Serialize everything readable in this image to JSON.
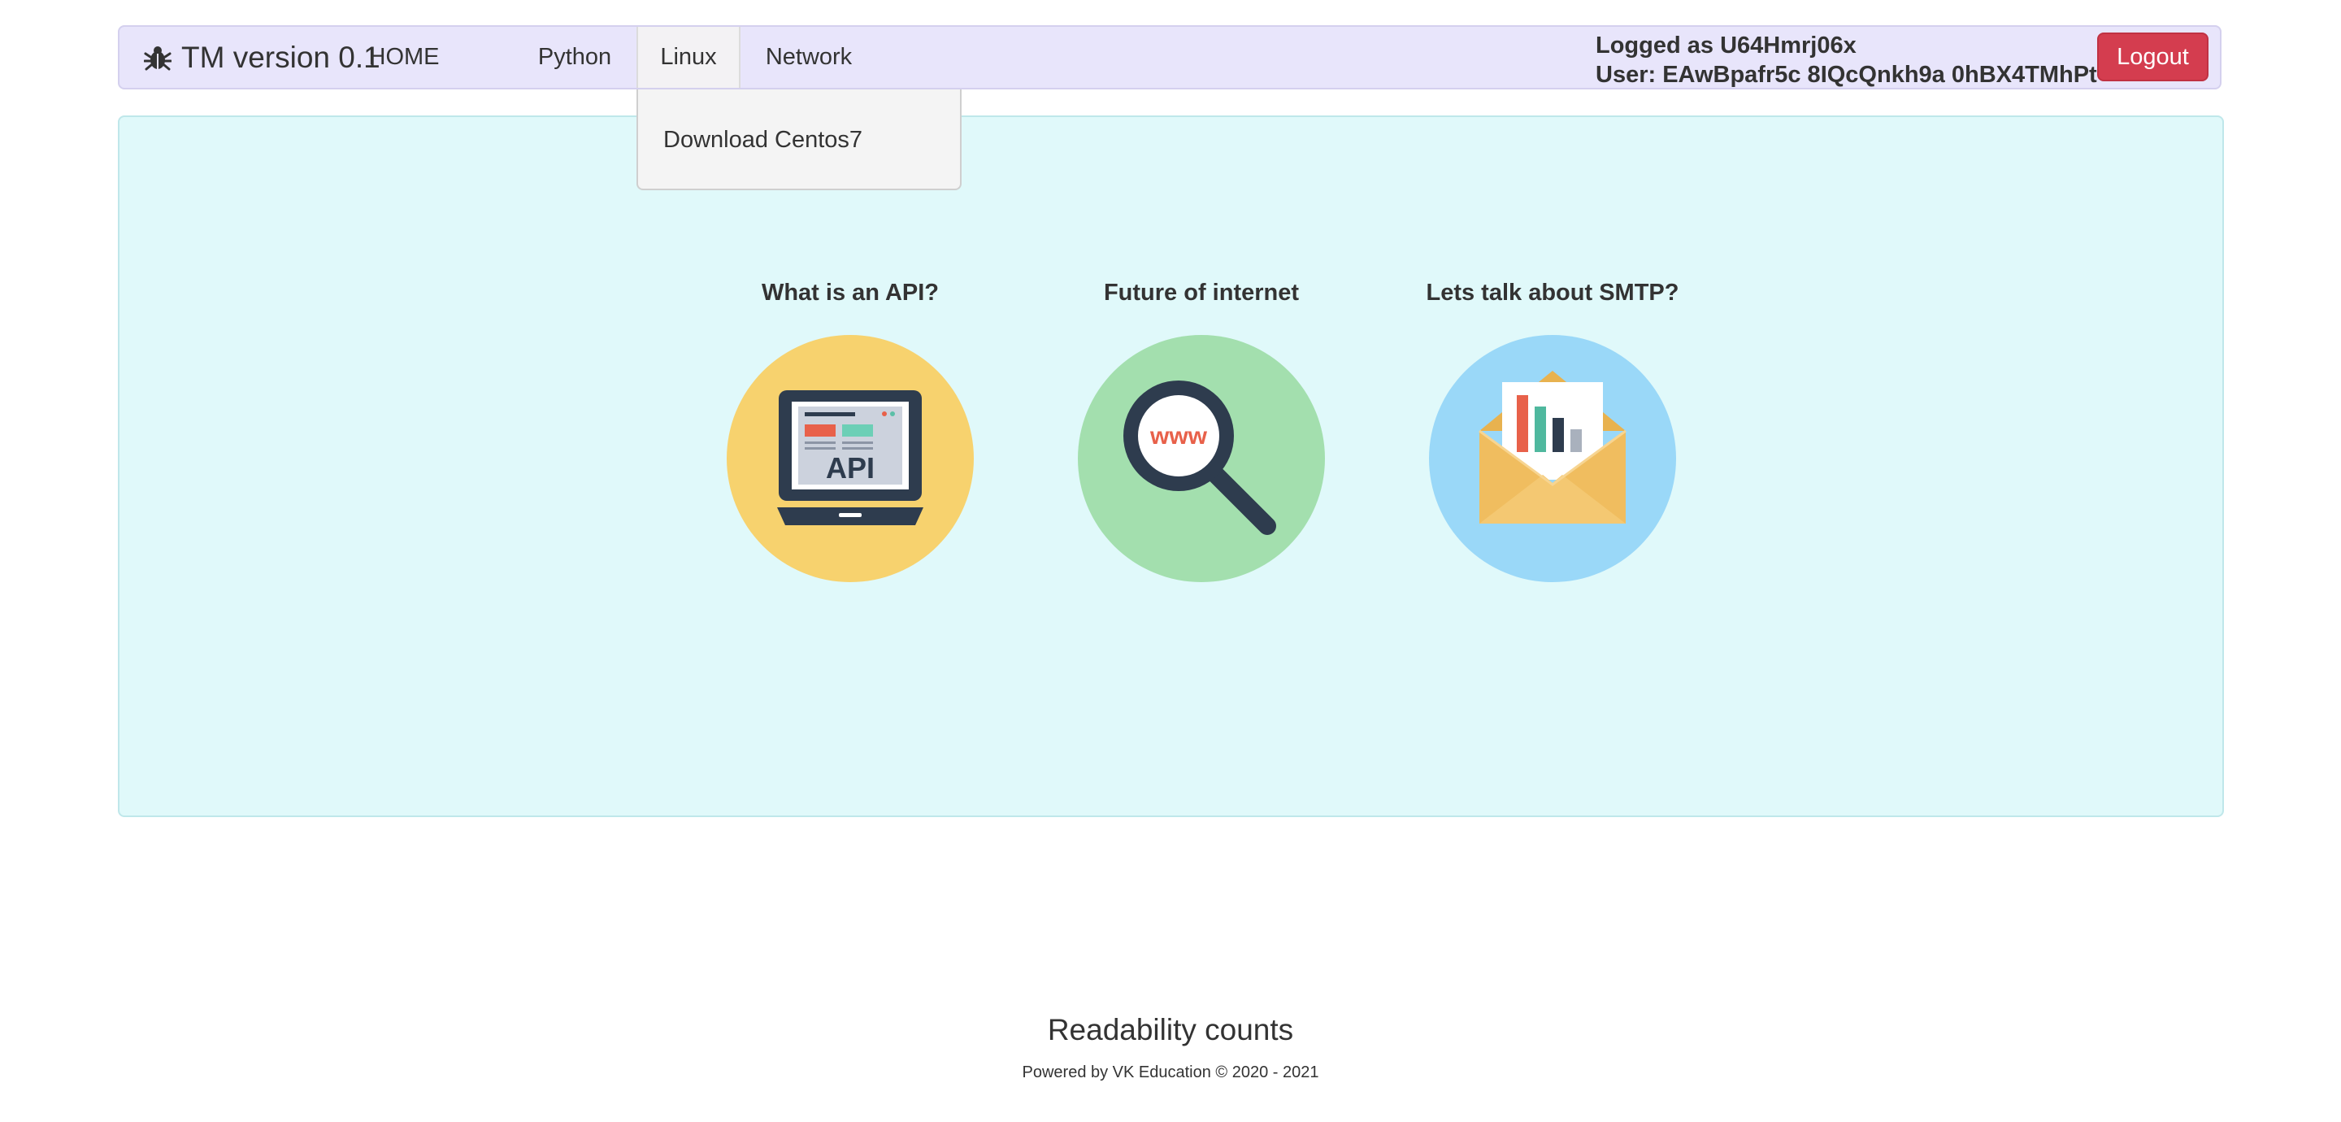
{
  "navbar": {
    "brand": "TM version 0.1",
    "items": [
      {
        "label": "HOME"
      },
      {
        "label": "Python"
      },
      {
        "label": "Linux"
      },
      {
        "label": "Network"
      }
    ],
    "linux_dropdown": {
      "items": [
        {
          "label": "Download Centos7"
        }
      ]
    },
    "logged_as": "Logged as U64Hmrj06x",
    "user": "User: EAwBpafr5c 8IQcQnkh9a 0hBX4TMhPt",
    "logout_label": "Logout"
  },
  "cards": [
    {
      "title": "What is an API?",
      "icon": "api-laptop-icon",
      "circle_color": "#f7d26e",
      "screen_text": "API"
    },
    {
      "title": "Future of internet",
      "icon": "www-magnifier-icon",
      "circle_color": "#a3dfae",
      "screen_text": "www"
    },
    {
      "title": "Lets talk about SMTP?",
      "icon": "envelope-chart-icon",
      "circle_color": "#9ad8f8"
    }
  ],
  "footer": {
    "title": "Readability counts",
    "subtitle": "Powered by VK Education © 2020 - 2021"
  },
  "colors": {
    "navbar_bg": "#e8e5fb",
    "panel_bg": "#e0f9fa",
    "logout_bg": "#d43d4f",
    "dark_icon": "#2e3c4e"
  }
}
